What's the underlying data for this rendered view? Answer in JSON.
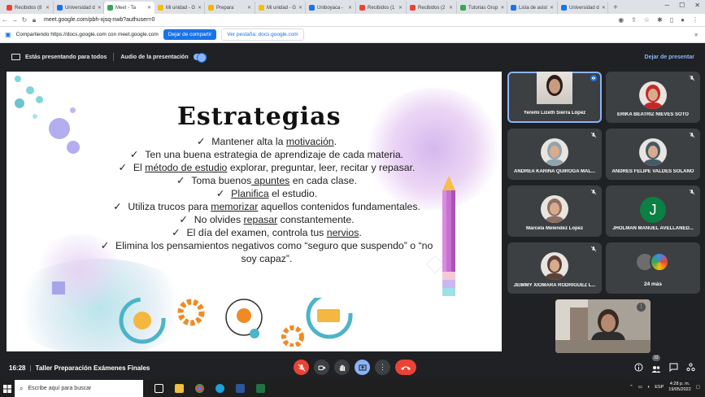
{
  "browser": {
    "tabs": [
      {
        "label": "Recibidos (8",
        "color": "#ea4335"
      },
      {
        "label": "Universidad d",
        "color": "#1a73e8"
      },
      {
        "label": "Meet - Ta",
        "color": "#34a853",
        "active": true
      },
      {
        "label": "Mi unidad - G",
        "color": "#fbbc04"
      },
      {
        "label": "Prepara",
        "color": "#f4b400"
      },
      {
        "label": "Mi unidad - G",
        "color": "#fbbc04"
      },
      {
        "label": "Uniboyaca -",
        "color": "#1a73e8"
      },
      {
        "label": "Recibidos (1",
        "color": "#ea4335"
      },
      {
        "label": "Recibidos (2",
        "color": "#ea4335"
      },
      {
        "label": "Tutorias Grup",
        "color": "#34a853"
      },
      {
        "label": "Lista de asist",
        "color": "#1a73e8"
      },
      {
        "label": "Universidad d",
        "color": "#1a73e8"
      }
    ],
    "url": "meet.google.com/pbh-xjsq-nwb?authuser=0"
  },
  "sharebar": {
    "text": "Compartiendo https://docs.google.com con meet.google.com",
    "stop_label": "Dejar de compartir",
    "view_label": "Ver pestaña: docs.google.com"
  },
  "presentbar": {
    "presenting_label": "Estás presentando para todos",
    "audio_label": "Audio de la presentación",
    "stop_label": "Dejar de presentar"
  },
  "slide": {
    "title": "Estrategias",
    "bullets": [
      {
        "check": "✓",
        "parts": [
          {
            "t": "Mantener alta la ",
            "u": false
          },
          {
            "t": "motivación",
            "u": true
          },
          {
            "t": ".",
            "u": false
          }
        ]
      },
      {
        "check": "✓",
        "parts": [
          {
            "t": "Ten una buena estrategia de aprendizaje de cada materia.",
            "u": false
          }
        ]
      },
      {
        "check": "✓",
        "parts": [
          {
            "t": "El ",
            "u": false
          },
          {
            "t": "método de estudio",
            "u": true
          },
          {
            "t": " explorar, preguntar, leer, recitar y repasar.",
            "u": false
          }
        ]
      },
      {
        "check": "✓",
        "parts": [
          {
            "t": "Toma buenos",
            "u": false
          },
          {
            "t": " apuntes",
            "u": true
          },
          {
            "t": " en cada clase.",
            "u": false
          }
        ]
      },
      {
        "check": "✓",
        "parts": [
          {
            "t": "Planifica",
            "u": true
          },
          {
            "t": " el estudio.",
            "u": false
          }
        ]
      },
      {
        "check": "✓",
        "parts": [
          {
            "t": "Utiliza trucos para ",
            "u": false
          },
          {
            "t": "memorizar",
            "u": true
          },
          {
            "t": " aquellos contenidos fundamentales.",
            "u": false
          }
        ]
      },
      {
        "check": "✓",
        "parts": [
          {
            "t": "No olvides ",
            "u": false
          },
          {
            "t": "repasar",
            "u": true
          },
          {
            "t": " constantemente.",
            "u": false
          }
        ]
      },
      {
        "check": "✓",
        "parts": [
          {
            "t": "El día del examen, controla tus ",
            "u": false
          },
          {
            "t": "nervios",
            "u": true
          },
          {
            "t": ".",
            "u": false
          }
        ]
      },
      {
        "check": "✓",
        "parts": [
          {
            "t": "Elimina los pensamientos negativos como “seguro que suspendo” o “no soy capaz”.",
            "u": false
          }
        ]
      }
    ]
  },
  "participants": [
    {
      "name": "Yeremi Lizeth Sierra López",
      "speaking": true,
      "avatar_color": "#6d4c41"
    },
    {
      "name": "ERIKA BEATRIZ NIEVES SOTO",
      "muted": true,
      "avatar_color": "#c62828"
    },
    {
      "name": "ANDREA KARINA QUIROGA MAL...",
      "muted": true,
      "avatar_color": "#90a4ae"
    },
    {
      "name": "ANDRES FELIPE VALDES SOLANO",
      "muted": true,
      "avatar_color": "#455a64"
    },
    {
      "name": "Marcela Melendez Lopez",
      "muted": true,
      "avatar_color": "#8d6e63"
    },
    {
      "name": "JHOLMAN MANUEL AVELLANED...",
      "muted": true,
      "letter": "J",
      "avatar_color": "#0b8043"
    },
    {
      "name": "JEIMMY XIOMARA RODRIGUEZ L...",
      "muted": true,
      "avatar_color": "#5d4037"
    },
    {
      "name": "24 más",
      "more": true
    }
  ],
  "meeting": {
    "time": "16:28",
    "separator": "|",
    "name": "Taller Preparación Exámenes Finales",
    "participant_count": "33"
  },
  "taskbar": {
    "search_placeholder": "Escribe aquí para buscar",
    "lang": "ESP",
    "clock_time": "4:28 p. m.",
    "clock_date": "19/05/2022"
  }
}
